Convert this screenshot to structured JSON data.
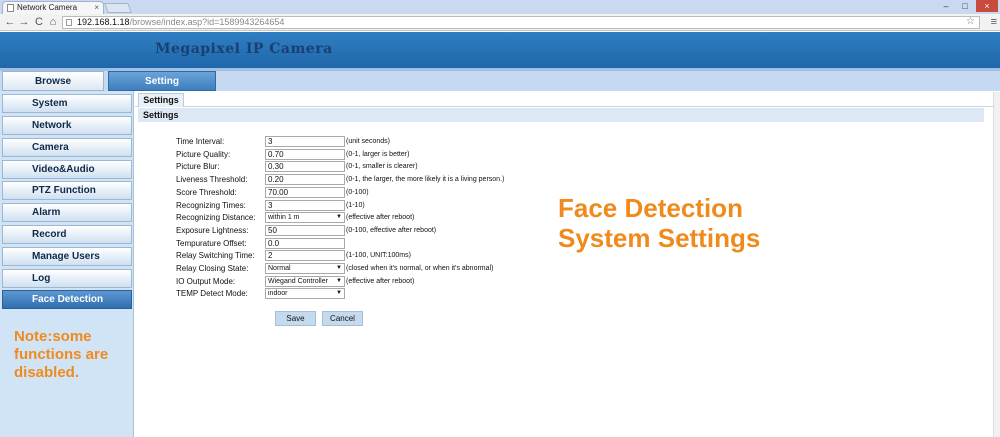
{
  "browser": {
    "tab_title": "Network Camera",
    "tab_close": "×",
    "url_host": "192.168.1.18",
    "url_path": "/browse/index.asp?id=1589943264654",
    "back": "←",
    "forward": "→",
    "reload": "C",
    "home": "⌂",
    "minimize": "–",
    "maximize": "□",
    "close": "×",
    "star": "☆",
    "menu": "≡"
  },
  "header": {
    "title": "Megapixel IP Camera"
  },
  "topnav": {
    "browse": "Browse",
    "setting": "Setting"
  },
  "sidebar": {
    "items": [
      {
        "label": "System"
      },
      {
        "label": "Network"
      },
      {
        "label": "Camera"
      },
      {
        "label": "Video&Audio"
      },
      {
        "label": "PTZ Function"
      },
      {
        "label": "Alarm"
      },
      {
        "label": "Record"
      },
      {
        "label": "Manage Users"
      },
      {
        "label": "Log"
      },
      {
        "label": "Face Detection"
      }
    ],
    "note_lines": [
      "Note:some",
      "functions are",
      "disabled."
    ]
  },
  "main": {
    "tab": "Settings",
    "section": "Settings",
    "fields": [
      {
        "label": "Time Interval:",
        "value": "3",
        "hint": "(unit seconds)"
      },
      {
        "label": "Picture Quality:",
        "value": "0.70",
        "hint": "(0-1, larger is better)"
      },
      {
        "label": "Picture Blur:",
        "value": "0.30",
        "hint": "(0-1, smaller is clearer)"
      },
      {
        "label": "Liveness Threshold:",
        "value": "0.20",
        "hint": "(0-1, the larger, the more likely it is a living person.)"
      },
      {
        "label": "Score Threshold:",
        "value": "70.00",
        "hint": "(0-100)"
      },
      {
        "label": "Recognizing Times:",
        "value": "3",
        "hint": "(1-10)"
      },
      {
        "label": "Recognizing Distance:",
        "value": "within 1  m",
        "hint": "(effective after reboot)"
      },
      {
        "label": "Exposure Lightness:",
        "value": "50",
        "hint": "(0-100, effective after reboot)"
      },
      {
        "label": "Tempurature Offset:",
        "value": "0.0",
        "hint": ""
      },
      {
        "label": "Relay Switching Time:",
        "value": "2",
        "hint": "(1-100, UNIT:100ms)"
      },
      {
        "label": "Relay Closing State:",
        "value": "Normal",
        "hint": "(closed when it's normal,  or when it's abnormal)"
      },
      {
        "label": "IO Output Mode:",
        "value": "Wiegand Controller",
        "hint": "(effective after reboot)"
      },
      {
        "label": "TEMP Detect Mode:",
        "value": "indoor",
        "hint": ""
      }
    ],
    "save": "Save",
    "cancel": "Cancel",
    "select_arrow": "▼"
  },
  "overlay": {
    "line1": "Face Detection",
    "line2": "System Settings"
  }
}
